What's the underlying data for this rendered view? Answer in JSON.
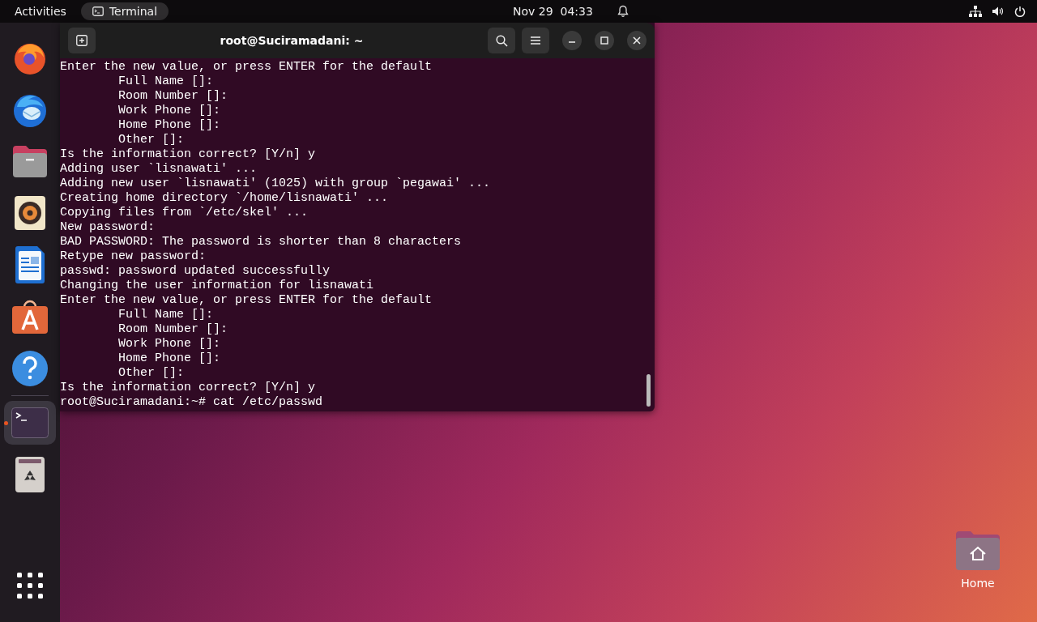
{
  "top_bar": {
    "activities": "Activities",
    "app": "Terminal",
    "date": "Nov 29",
    "time": "04:33"
  },
  "dock": [
    {
      "kind": "firefox",
      "selected": false,
      "running": false
    },
    {
      "kind": "thunderbird",
      "selected": false,
      "running": false
    },
    {
      "kind": "files",
      "selected": false,
      "running": false
    },
    {
      "kind": "rhythmbox",
      "selected": false,
      "running": false
    },
    {
      "kind": "writer",
      "selected": false,
      "running": false
    },
    {
      "kind": "software",
      "selected": false,
      "running": false
    },
    {
      "kind": "help",
      "selected": false,
      "running": false
    },
    {
      "kind": "terminal",
      "selected": true,
      "running": true
    },
    {
      "kind": "trash",
      "selected": false,
      "running": false
    },
    {
      "kind": "apps",
      "selected": false,
      "running": false
    }
  ],
  "terminal": {
    "title": "root@Suciramadani: ~",
    "lines": [
      "Enter the new value, or press ENTER for the default",
      "        Full Name []:",
      "        Room Number []:",
      "        Work Phone []:",
      "        Home Phone []:",
      "        Other []:",
      "Is the information correct? [Y/n] y",
      "Adding user `lisnawati' ...",
      "Adding new user `lisnawati' (1025) with group `pegawai' ...",
      "Creating home directory `/home/lisnawati' ...",
      "Copying files from `/etc/skel' ...",
      "New password:",
      "BAD PASSWORD: The password is shorter than 8 characters",
      "Retype new password:",
      "passwd: password updated successfully",
      "Changing the user information for lisnawati",
      "Enter the new value, or press ENTER for the default",
      "        Full Name []:",
      "        Room Number []:",
      "        Work Phone []:",
      "        Home Phone []:",
      "        Other []:",
      "Is the information correct? [Y/n] y",
      "root@Suciramadani:~# cat /etc/passwd"
    ]
  },
  "desktop": {
    "home_label": "Home"
  }
}
